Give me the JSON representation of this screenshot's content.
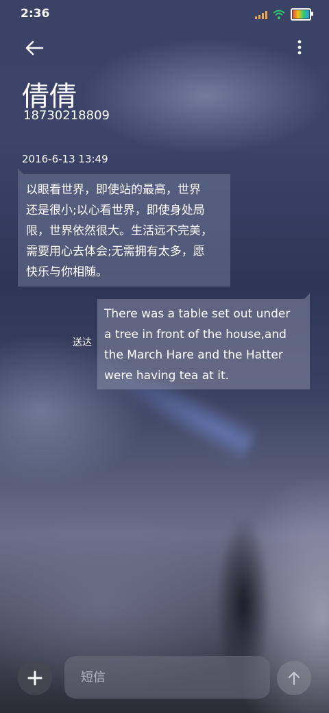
{
  "status_bar": {
    "time": "2:36",
    "icons": [
      "signal-icon",
      "wifi-icon",
      "battery-icon"
    ]
  },
  "header": {
    "back_icon": "arrow-left-icon",
    "more_icon": "more-vertical-icon",
    "contact_name": "倩倩",
    "contact_number": "18730218809"
  },
  "conversation": {
    "timestamp": "2016-6-13 13:49",
    "incoming": {
      "lines": [
        "以眼看世界，即使站的最高，世界",
        "还是很小;以心看世界，即使身处局",
        "限，世界依然很大。生活远不完美，",
        "需要用心去体会;无需拥有太多，愿",
        "快乐与你相随。"
      ]
    },
    "outgoing": {
      "status": "送达",
      "lines": [
        "There was a table set out under",
        "a tree in front of the house,and",
        "the March Hare and the Hatter",
        "were having tea at it."
      ]
    }
  },
  "composer": {
    "add_icon": "plus-icon",
    "placeholder": "短信",
    "send_icon": "arrow-up-icon"
  },
  "colors": {
    "status_signal": "#f1a84a",
    "wifi": "#2ecc71",
    "text": "#ffffff"
  }
}
